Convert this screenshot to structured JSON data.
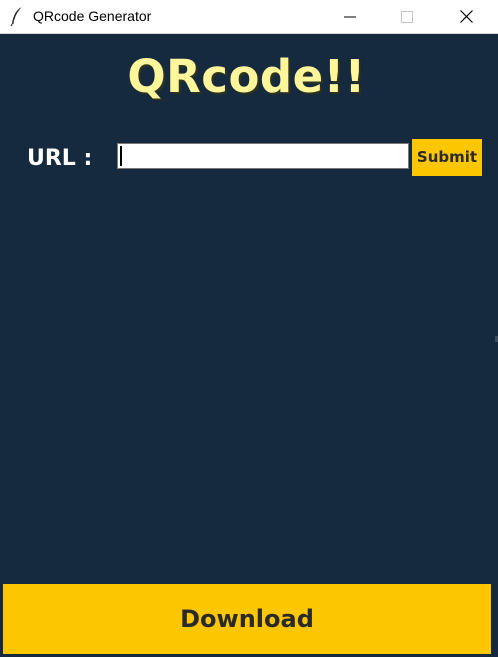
{
  "window": {
    "title": "QRcode Generator",
    "icon": "feather-icon",
    "controls": [
      "minimize-icon",
      "maximize-icon",
      "close-icon"
    ]
  },
  "main": {
    "heading": "QRcode!!",
    "url_label": "URL :",
    "url_input": {
      "value": "",
      "placeholder": ""
    },
    "submit_label": "Submit",
    "download_label": "Download"
  },
  "colors": {
    "background": "#152a3e",
    "button": "#fcc600",
    "heading": "#fff59a",
    "label": "#ffffff",
    "button_text": "#2a2a2a"
  }
}
